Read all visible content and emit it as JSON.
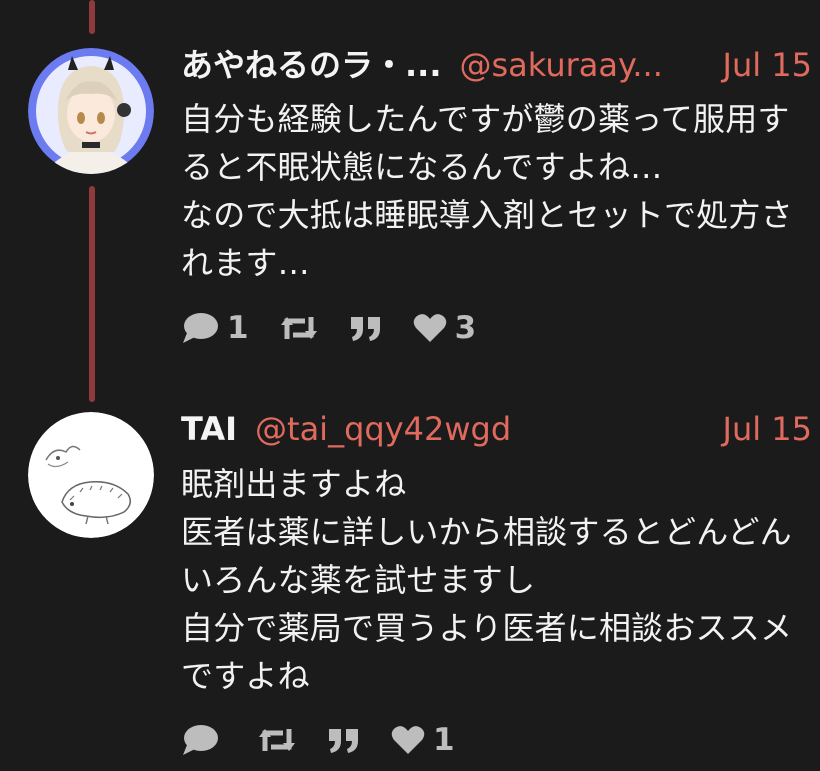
{
  "posts": [
    {
      "name": "あやねるのラ・...",
      "handle": "@sakuraay...",
      "date": "Jul 15",
      "text": "自分も経験したんですが鬱の薬って服用すると不眠状態になるんですよね…\nなので大抵は睡眠導入剤とセットで処方されます…",
      "reply_count": "1",
      "like_count": "3",
      "avatar_icon": "anime-girl-avatar"
    },
    {
      "name": "TAI",
      "handle": "@tai_qqy42wgd",
      "date": "Jul 15",
      "text": "眠剤出ますよね\n医者は薬に詳しいから相談するとどんどんいろんな薬を試せますし\n自分で薬局で買うより医者に相談おススメですよね",
      "reply_count": "",
      "like_count": "1",
      "avatar_icon": "sketch-animal-avatar"
    }
  ],
  "colors": {
    "background": "#1c1b1c",
    "accent": "#e06a5d",
    "thread_line": "#8f3a3c",
    "icon": "#bdbdbd"
  },
  "icons": [
    "reply-icon",
    "retweet-icon",
    "quote-icon",
    "heart-icon"
  ]
}
